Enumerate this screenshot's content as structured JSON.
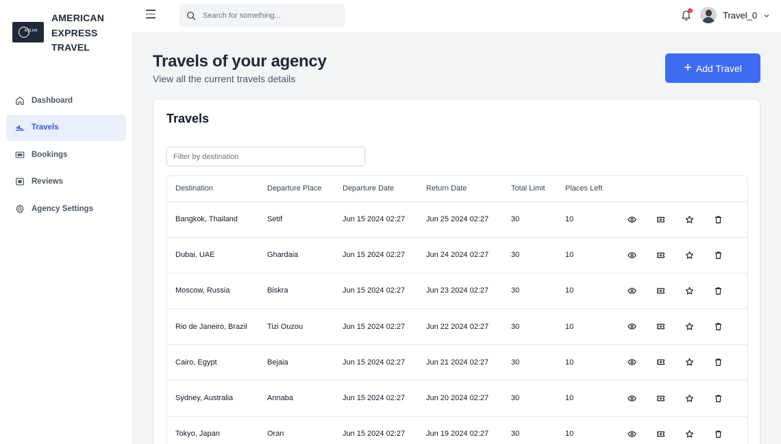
{
  "brand": {
    "logo_text": "MyLink",
    "name": "AMERICAN\nEXPRESS\nTRAVEL"
  },
  "sidebar": {
    "items": [
      {
        "label": "Dashboard",
        "icon": "home-icon",
        "active": false
      },
      {
        "label": "Travels",
        "icon": "plane-icon",
        "active": true
      },
      {
        "label": "Bookings",
        "icon": "ticket-icon",
        "active": false
      },
      {
        "label": "Reviews",
        "icon": "review-icon",
        "active": false
      },
      {
        "label": "Agency Settings",
        "icon": "gear-icon",
        "active": false
      }
    ]
  },
  "topbar": {
    "search_placeholder": "Search for something...",
    "username": "Travel_0"
  },
  "page": {
    "title": "Travels of your agency",
    "subtitle": "View all the current travels details",
    "add_button": "Add Travel"
  },
  "card": {
    "title": "Travels",
    "filter_placeholder": "Filter by destination"
  },
  "table": {
    "columns": [
      "Destination",
      "Departure Place",
      "Departure Date",
      "Return Date",
      "Total Limit",
      "Places Left"
    ],
    "rows": [
      [
        "Bangkok, Thailand",
        "Setif",
        "Jun 15 2024 02:27",
        "Jun 25 2024 02:27",
        "30",
        "10"
      ],
      [
        "Dubai, UAE",
        "Ghardaia",
        "Jun 15 2024 02:27",
        "Jun 24 2024 02:27",
        "30",
        "10"
      ],
      [
        "Moscow, Russia",
        "Biskra",
        "Jun 15 2024 02:27",
        "Jun 23 2024 02:27",
        "30",
        "10"
      ],
      [
        "Rio de Janeiro, Brazil",
        "Tizi Ouzou",
        "Jun 15 2024 02:27",
        "Jun 22 2024 02:27",
        "30",
        "10"
      ],
      [
        "Cairo, Egypt",
        "Bejaia",
        "Jun 15 2024 02:27",
        "Jun 21 2024 02:27",
        "30",
        "10"
      ],
      [
        "Sydney, Australia",
        "Annaba",
        "Jun 15 2024 02:27",
        "Jun 20 2024 02:27",
        "30",
        "10"
      ],
      [
        "Tokyo, Japan",
        "Oran",
        "Jun 15 2024 02:27",
        "Jun 19 2024 02:27",
        "30",
        "10"
      ]
    ],
    "row_actions": [
      "eye-icon",
      "ticket-icon",
      "star-icon",
      "trash-icon"
    ]
  },
  "colors": {
    "accent": "#3e6cf0",
    "active_nav_bg": "#eaf0fb",
    "active_nav_text": "#3b5bdb",
    "notification_dot": "#ef4444"
  }
}
